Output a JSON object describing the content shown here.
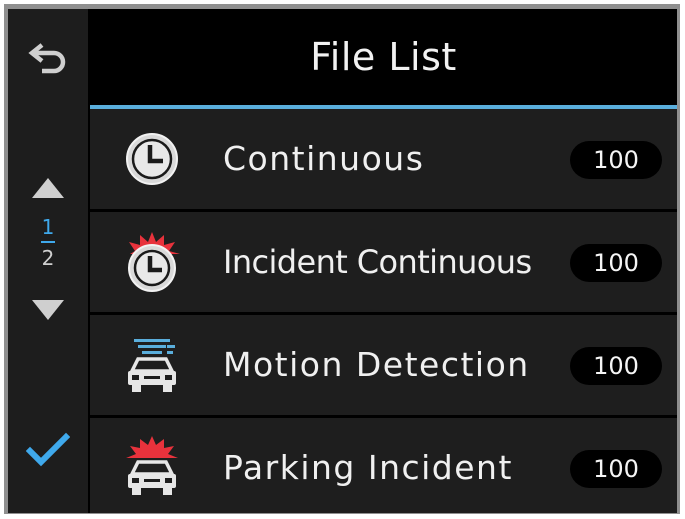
{
  "header": {
    "title": "File List"
  },
  "sidebar": {
    "back_icon": "back-arrow-icon",
    "up_icon": "triangle-up-icon",
    "down_icon": "triangle-down-icon",
    "confirm_icon": "checkmark-icon",
    "page_current": "1",
    "page_total": "2"
  },
  "list": {
    "items": [
      {
        "label": "Continuous",
        "count": "100",
        "icon": "clock-icon"
      },
      {
        "label": "Incident Continuous",
        "count": "100",
        "icon": "incident-clock-icon"
      },
      {
        "label": "Motion Detection",
        "count": "100",
        "icon": "motion-car-icon"
      },
      {
        "label": "Parking Incident",
        "count": "100",
        "icon": "parking-incident-car-icon"
      }
    ]
  },
  "colors": {
    "accent": "#3fa9ec",
    "header_underline": "#5aaedc",
    "row_background": "#1e1e1e",
    "sidebar_background": "#1d1d1d",
    "incident_red": "#e8323c"
  }
}
